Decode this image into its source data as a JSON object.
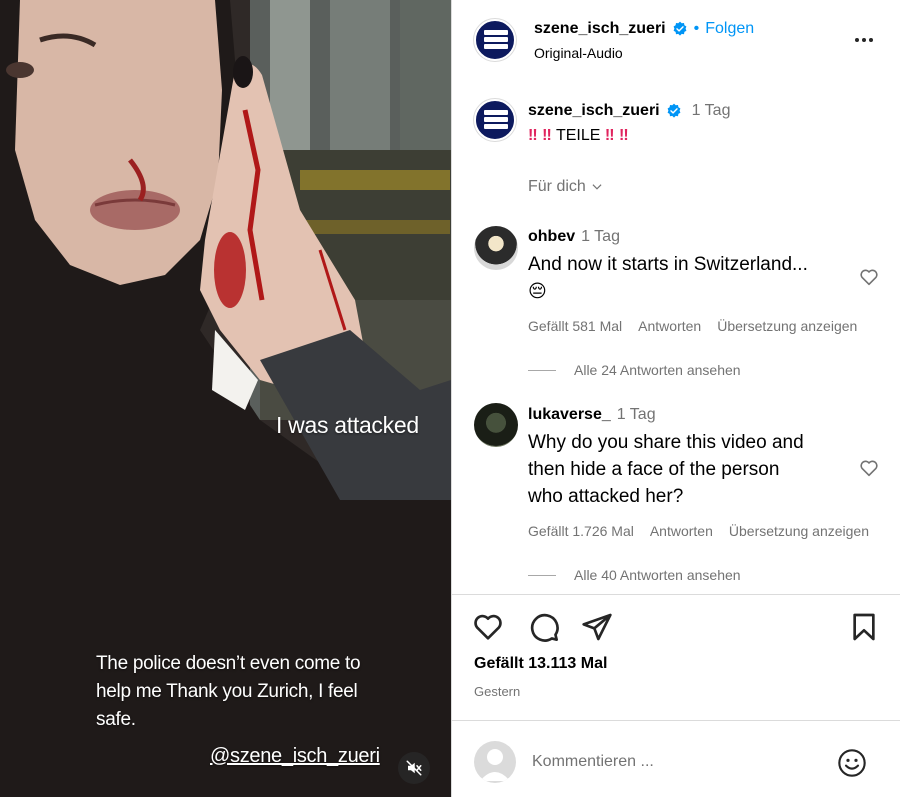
{
  "video": {
    "captions": {
      "attacked": "I was attacked",
      "police": "The police doesn’t even come to help me  Thank you Zurich, I feel safe.",
      "handle": "@szene_isch_zueri"
    },
    "mute_icon": "speaker-muted-icon"
  },
  "header": {
    "username": "szene_isch_zueri",
    "separator": "•",
    "follow_label": "Folgen",
    "audio": "Original-Audio",
    "more_icon": "more-horizontal-icon"
  },
  "caption": {
    "username": "szene_isch_zueri",
    "time": "1 Tag",
    "bang1": "‼",
    "bang2": "‼",
    "word": "TEILE",
    "bang3": "‼",
    "bang4": "‼",
    "for_you": "Für dich"
  },
  "comments": [
    {
      "username": "ohbev",
      "time": "1 Tag",
      "text": "And now it starts in Switzerland...",
      "emoji": "😔",
      "likes": "Gefällt 581 Mal",
      "reply_label": "Antworten",
      "translate_label": "Übersetzung anzeigen",
      "view_replies": "Alle 24 Antworten ansehen"
    },
    {
      "username": "lukaverse_",
      "time": "1 Tag",
      "text_line1": "Why do you share this video and",
      "text_line2": "then hide a face of the person",
      "text_line3": "who attacked her?",
      "likes": "Gefällt 1.726 Mal",
      "reply_label": "Antworten",
      "translate_label": "Übersetzung anzeigen",
      "view_replies": "Alle 40 Antworten ansehen"
    }
  ],
  "actions": {
    "likes": "Gefällt 13.113 Mal",
    "date": "Gestern"
  },
  "comment_box": {
    "placeholder": "Kommentieren ..."
  },
  "colors": {
    "link_blue": "#0095f6",
    "muted_text": "#737373",
    "border": "#dbdbdb",
    "avatar_navy": "#0d1a5e"
  }
}
